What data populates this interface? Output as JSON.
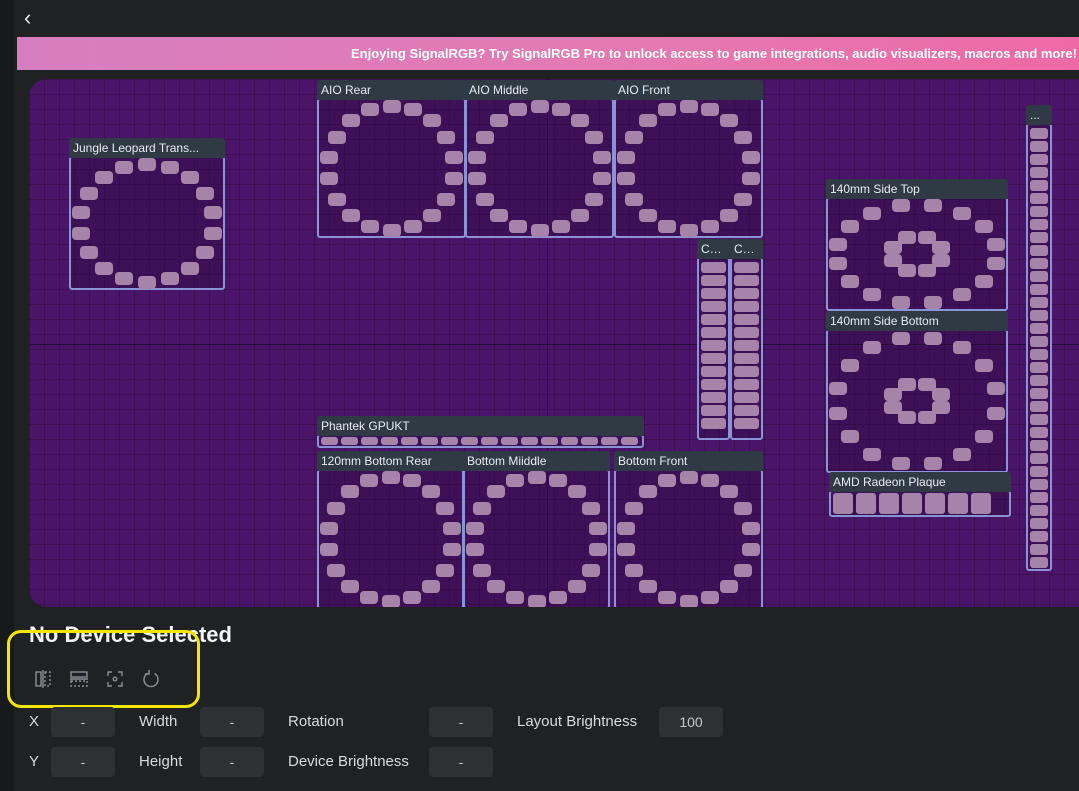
{
  "nav": {
    "back_glyph": "‹",
    "back_icon": "chevron-left-icon"
  },
  "banner": {
    "text": "Enjoying SignalRGB? Try SignalRGB Pro to unlock access to game integrations, audio visualizers, macros and more!"
  },
  "devices": {
    "jungle": "Jungle Leopard Trans...",
    "aio_rear": "AIO Rear",
    "aio_middle": "AIO Middle",
    "aio_front": "AIO Front",
    "co1": "Co...",
    "co2": "Co...",
    "side_top": "140mm Side Top",
    "side_bottom": "140mm Side Bottom",
    "right_strip": "...",
    "gpu": "Phantek GPUKT",
    "bottom_rear": "120mm Bottom Rear",
    "bottom_middle": "Bottom Miiddle",
    "bottom_front": "Bottom Front",
    "amd": "AMD Radeon Plaque"
  },
  "panel": {
    "title": "No Device Selected",
    "tools": [
      "flip-horizontal-icon",
      "flip-vertical-icon",
      "center-icon",
      "rotate-reset-icon"
    ],
    "fields": {
      "x": {
        "label": "X",
        "value": "-"
      },
      "width": {
        "label": "Width",
        "value": "-"
      },
      "rotation": {
        "label": "Rotation",
        "value": "-"
      },
      "layout_brightness": {
        "label": "Layout Brightness",
        "value": "100"
      },
      "y": {
        "label": "Y",
        "value": "-"
      },
      "height": {
        "label": "Height",
        "value": "-"
      },
      "device_brightness": {
        "label": "Device Brightness",
        "value": "-"
      }
    }
  },
  "colors": {
    "canvas": "#4a1468",
    "led": "#a683a8",
    "device_border": "#8a93d6",
    "highlight": "#f3e600"
  }
}
